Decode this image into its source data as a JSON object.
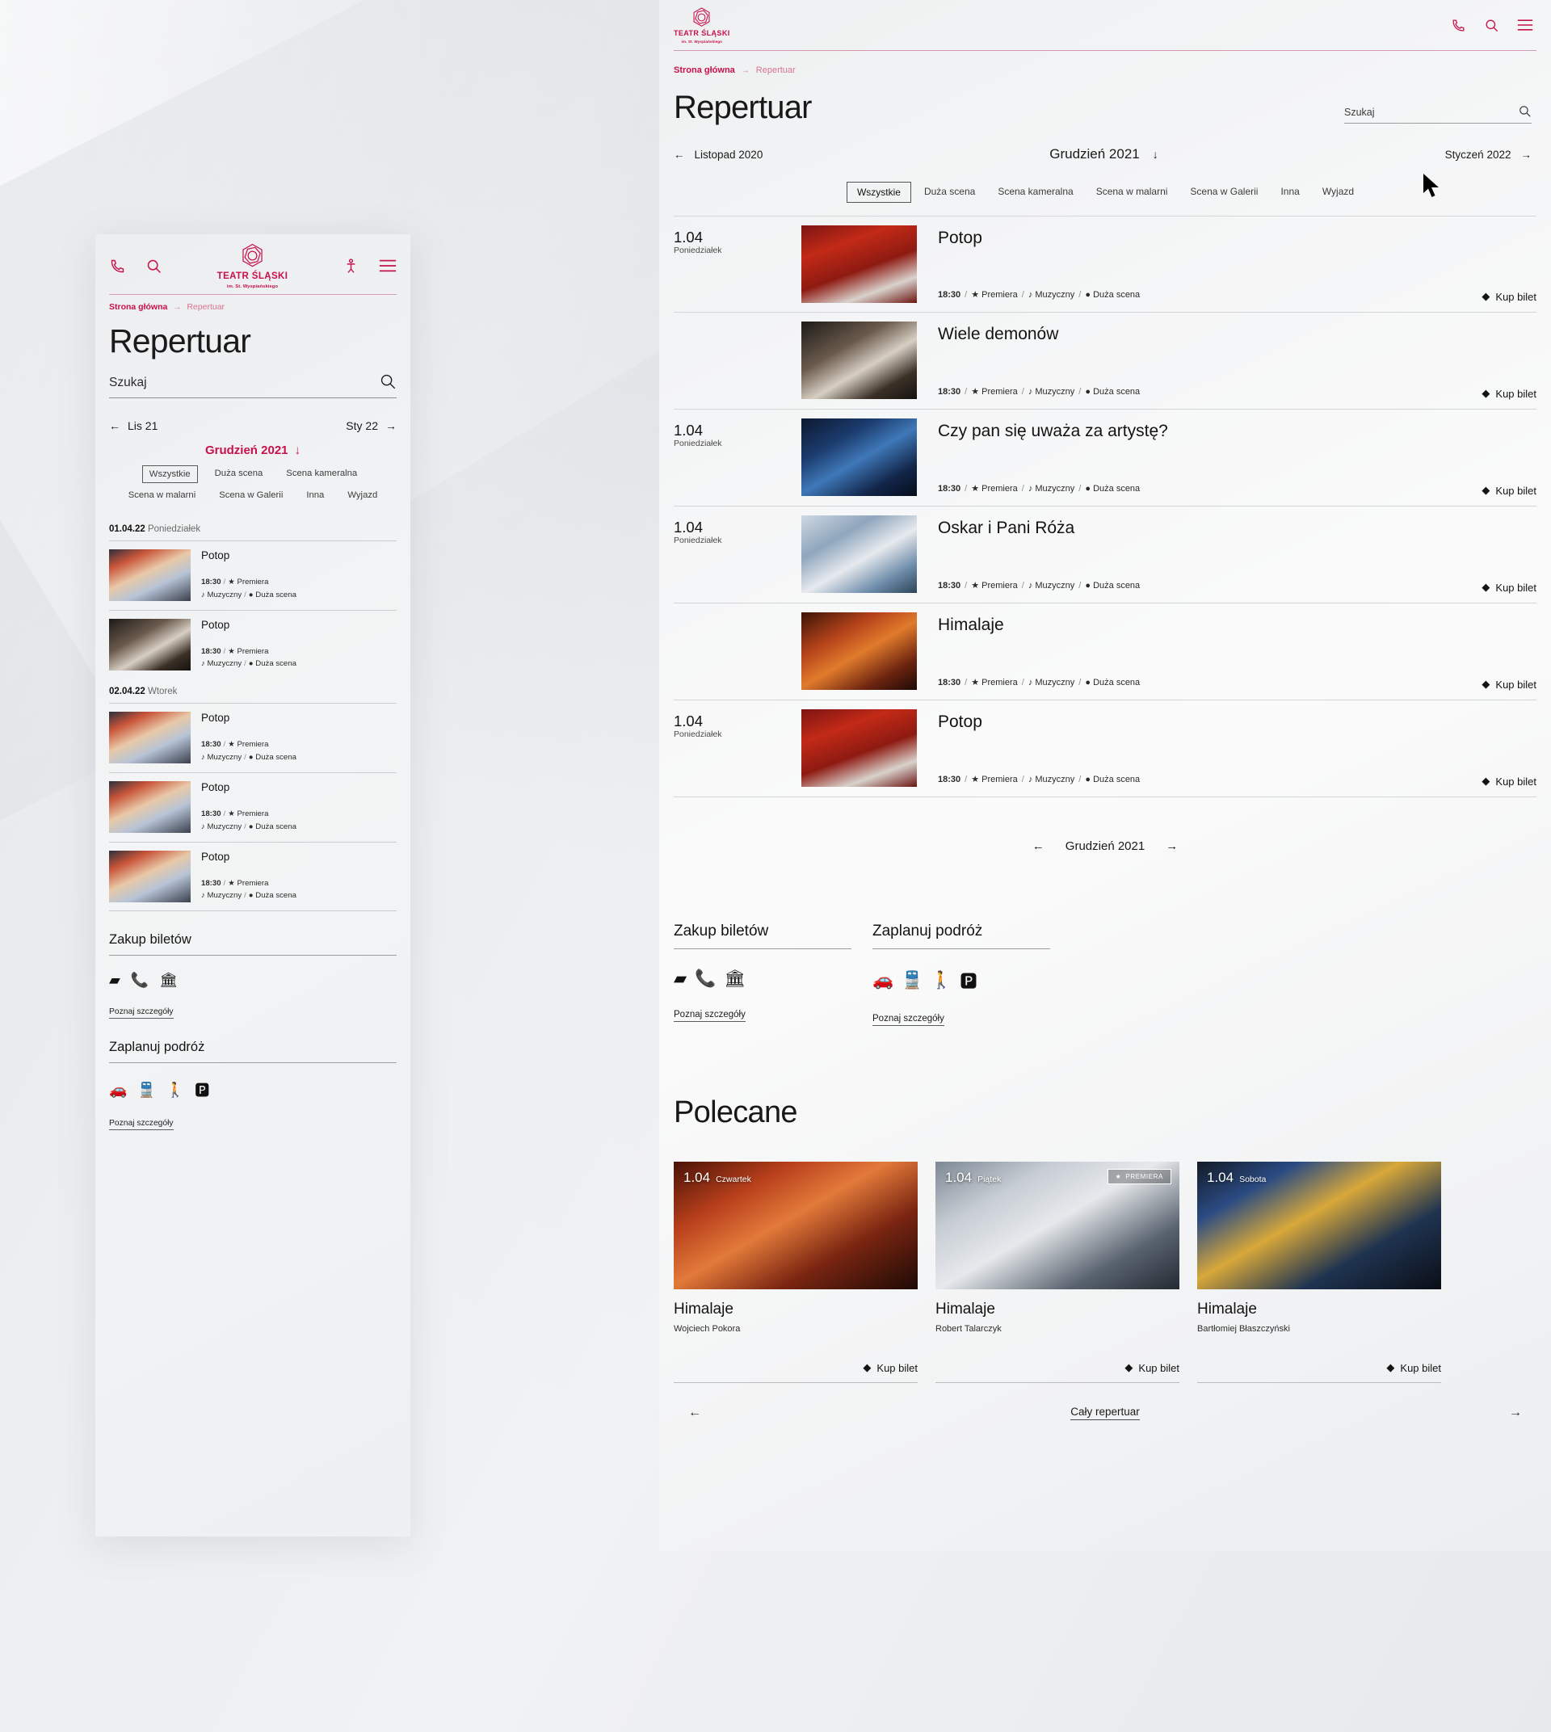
{
  "brand": {
    "name": "TEATR ŚLĄSKI",
    "subtitle": "im. St. Wyspiańskiego",
    "accent": "#c8104a"
  },
  "breadcrumb": {
    "home": "Strona główna",
    "arrow": "→",
    "current": "Repertuar"
  },
  "page": {
    "title": "Repertuar"
  },
  "search": {
    "placeholder": "Szukaj",
    "icon": "search-icon"
  },
  "topbar_icons": [
    "phone-icon",
    "search-icon",
    "person-icon",
    "hamburger-icon"
  ],
  "month_nav": {
    "prev_desktop": "Listopad 2020",
    "next_desktop": "Styczeń 2022",
    "prev_mobile": "Lis  21",
    "next_mobile": "Sty  22",
    "current": "Grudzień 2021",
    "dropdown_icon": "chevron-down-icon",
    "prev_icon": "arrow-left-icon",
    "next_icon": "arrow-right-icon"
  },
  "filters": {
    "items": [
      {
        "label": "Wszystkie",
        "active": true
      },
      {
        "label": "Duża scena",
        "active": false
      },
      {
        "label": "Scena kameralna",
        "active": false
      },
      {
        "label": "Scena w malarni",
        "active": false
      },
      {
        "label": "Scena w Galerii",
        "active": false
      },
      {
        "label": "Inna",
        "active": false
      },
      {
        "label": "Wyjazd",
        "active": false
      }
    ]
  },
  "buy_label": "Kup bilet",
  "desktop_events": [
    {
      "date": "1.04",
      "day": "Poniedziałek",
      "show_date": true,
      "title": "Potop",
      "time": "18:30",
      "tag1": "Premiera",
      "tag2": "Muzyczny",
      "stage": "Duża scena",
      "img": "potop-red"
    },
    {
      "date": "",
      "day": "",
      "show_date": false,
      "title": "Wiele demonów",
      "time": "18:30",
      "tag1": "Premiera",
      "tag2": "Muzyczny",
      "stage": "Duża scena",
      "img": "demony"
    },
    {
      "date": "1.04",
      "day": "Poniedziałek",
      "show_date": true,
      "title": "Czy pan się uważa za artystę?",
      "time": "18:30",
      "tag1": "Premiera",
      "tag2": "Muzyczny",
      "stage": "Duża scena",
      "img": "artysta"
    },
    {
      "date": "1.04",
      "day": "Poniedziałek",
      "show_date": true,
      "title": "Oskar i Pani Róża",
      "time": "18:30",
      "tag1": "Premiera",
      "tag2": "Muzyczny",
      "stage": "Duża scena",
      "img": "oskar"
    },
    {
      "date": "",
      "day": "",
      "show_date": false,
      "title": "Himalaje",
      "time": "18:30",
      "tag1": "Premiera",
      "tag2": "Muzyczny",
      "stage": "Duża scena",
      "img": "himalaje"
    },
    {
      "date": "1.04",
      "day": "Poniedziałek",
      "show_date": true,
      "title": "Potop",
      "time": "18:30",
      "tag1": "Premiera",
      "tag2": "Muzyczny",
      "stage": "Duża scena",
      "img": "potop-red"
    }
  ],
  "mobile_groups": [
    {
      "date": "01.04.22",
      "day": "Poniedziałek",
      "events": [
        {
          "title": "Potop",
          "time": "18:30",
          "tag1": "Premiera",
          "tag2": "Muzyczny",
          "stage": "Duża scena",
          "img": "potop-ship"
        },
        {
          "title": "Potop",
          "time": "18:30",
          "tag1": "Premiera",
          "tag2": "Muzyczny",
          "stage": "Duża scena",
          "img": "demony"
        }
      ]
    },
    {
      "date": "02.04.22",
      "day": "Wtorek",
      "events": [
        {
          "title": "Potop",
          "time": "18:30",
          "tag1": "Premiera",
          "tag2": "Muzyczny",
          "stage": "Duża scena",
          "img": "potop-ship"
        },
        {
          "title": "Potop",
          "time": "18:30",
          "tag1": "Premiera",
          "tag2": "Muzyczny",
          "stage": "Duża scena",
          "img": "potop-ship"
        },
        {
          "title": "Potop",
          "time": "18:30",
          "tag1": "Premiera",
          "tag2": "Muzyczny",
          "stage": "Duża scena",
          "img": "potop-ship"
        }
      ]
    }
  ],
  "info_sections": [
    {
      "title": "Zakup biletów",
      "icons": [
        "laptop-icon",
        "phone-handset-icon",
        "bank-icon"
      ],
      "link": "Poznaj szczegóły"
    },
    {
      "title": "Zaplanuj podróż",
      "icons": [
        "car-icon",
        "train-icon",
        "walk-icon",
        "parking-icon"
      ],
      "link": "Poznaj szczegóły"
    }
  ],
  "recommended": {
    "heading": "Polecane",
    "premiere_badge": "PREMIERA",
    "all_link": "Cały repertuar",
    "cards": [
      {
        "date": "1.04",
        "day": "Czwartek",
        "title": "Himalaje",
        "author": "Wojciech Pokora",
        "premiere": false,
        "img": "card-red"
      },
      {
        "date": "1.04",
        "day": "Piątek",
        "title": "Himalaje",
        "author": "Robert Talarczyk",
        "premiere": true,
        "img": "card-grey"
      },
      {
        "date": "1.04",
        "day": "Sobota",
        "title": "Himalaje",
        "author": "Bartłomiej Błaszczyński",
        "premiere": false,
        "img": "card-blue"
      }
    ]
  },
  "bottom_pager": {
    "label": "Grudzień 2021"
  }
}
